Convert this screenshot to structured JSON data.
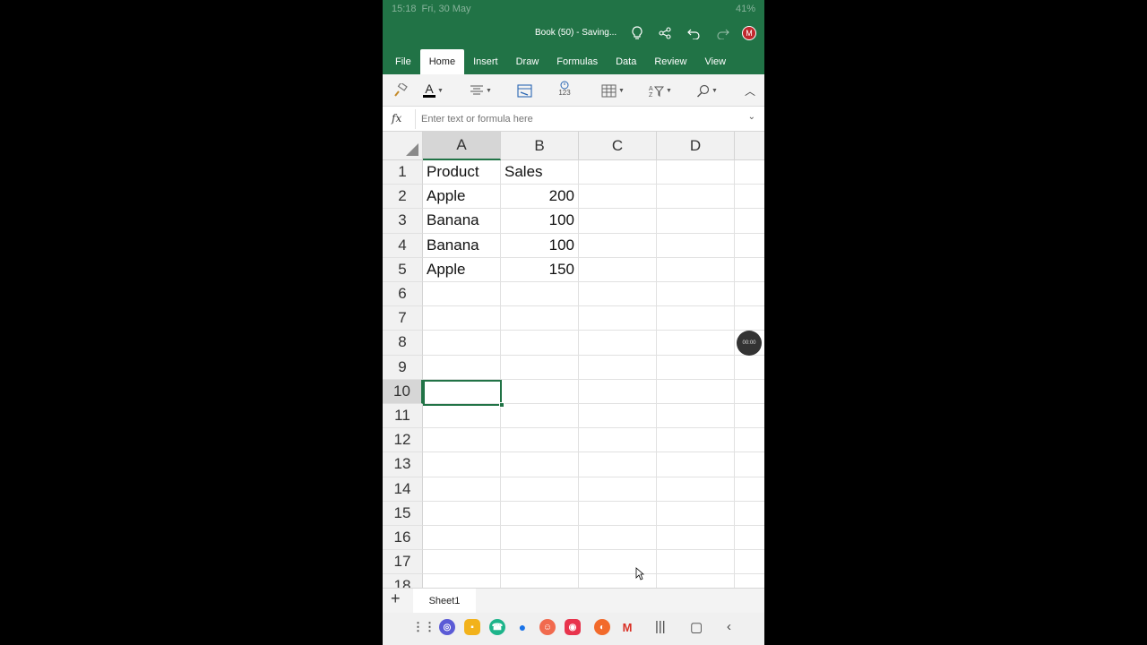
{
  "status": {
    "time": "15:18",
    "date": "Fri, 30 May",
    "battery": "41%"
  },
  "title_bar": {
    "doc_title": "Book (50) - Saving...",
    "avatar_initial": "M"
  },
  "ribbon_tabs": [
    {
      "label": "File",
      "active": false
    },
    {
      "label": "Home",
      "active": true
    },
    {
      "label": "Insert",
      "active": false
    },
    {
      "label": "Draw",
      "active": false
    },
    {
      "label": "Formulas",
      "active": false
    },
    {
      "label": "Data",
      "active": false
    },
    {
      "label": "Review",
      "active": false
    },
    {
      "label": "View",
      "active": false
    }
  ],
  "toolbar": {
    "font_color_letter": "A",
    "number_format_label": "123"
  },
  "formula_bar": {
    "fx_label": "fx",
    "placeholder": "Enter text or formula here",
    "value": ""
  },
  "columns": [
    "A",
    "B",
    "C",
    "D"
  ],
  "selected_column": "A",
  "rows": [
    {
      "n": "1",
      "a": "Product",
      "b": "Sales",
      "b_num": false
    },
    {
      "n": "2",
      "a": "Apple",
      "b": "200",
      "b_num": true
    },
    {
      "n": "3",
      "a": "Banana",
      "b": "100",
      "b_num": true
    },
    {
      "n": "4",
      "a": "Banana",
      "b": "100",
      "b_num": true
    },
    {
      "n": "5",
      "a": "Apple",
      "b": "150",
      "b_num": true
    },
    {
      "n": "6",
      "a": "",
      "b": ""
    },
    {
      "n": "7",
      "a": "",
      "b": ""
    },
    {
      "n": "8",
      "a": "",
      "b": ""
    },
    {
      "n": "9",
      "a": "",
      "b": ""
    },
    {
      "n": "10",
      "a": "",
      "b": ""
    },
    {
      "n": "11",
      "a": "",
      "b": ""
    },
    {
      "n": "12",
      "a": "",
      "b": ""
    },
    {
      "n": "13",
      "a": "",
      "b": ""
    },
    {
      "n": "14",
      "a": "",
      "b": ""
    },
    {
      "n": "15",
      "a": "",
      "b": ""
    },
    {
      "n": "16",
      "a": "",
      "b": ""
    },
    {
      "n": "17",
      "a": "",
      "b": ""
    },
    {
      "n": "18",
      "a": "",
      "b": ""
    }
  ],
  "selected_row": "10",
  "recording_badge": "00:00",
  "sheets": [
    {
      "label": "Sheet1"
    }
  ],
  "add_sheet_label": "+",
  "colors": {
    "excel_green": "#217346",
    "avatar_red": "#c0282d"
  }
}
